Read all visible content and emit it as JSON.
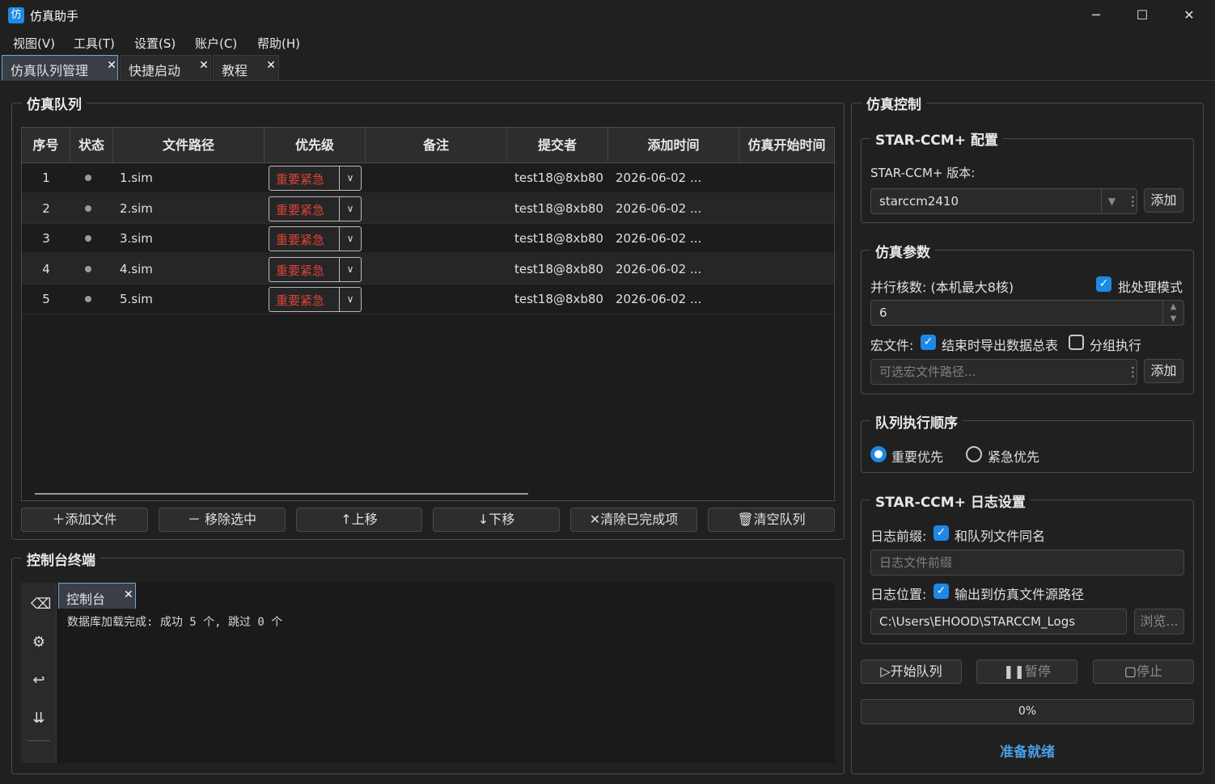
{
  "window": {
    "icon_char": "仿",
    "title": "仿真助手",
    "minimize": "─",
    "maximize": "☐",
    "close": "✕"
  },
  "menu": [
    "视图(V)",
    "工具(T)",
    "设置(S)",
    "账户(C)",
    "帮助(H)"
  ],
  "tabs": [
    {
      "label": "仿真队列管理",
      "active": true
    },
    {
      "label": "快捷启动",
      "active": false
    },
    {
      "label": "教程",
      "active": false
    }
  ],
  "queue": {
    "title": "仿真队列",
    "columns": [
      "序号",
      "状态",
      "文件路径",
      "优先级",
      "备注",
      "提交者",
      "添加时间",
      "仿真开始时间"
    ],
    "rows": [
      {
        "index": "1",
        "file": "1.sim",
        "priority": "重要紧急",
        "note": "",
        "submitter": "test18@8xb80",
        "added": "2026-06-02 ...",
        "start": ""
      },
      {
        "index": "2",
        "file": "2.sim",
        "priority": "重要紧急",
        "note": "",
        "submitter": "test18@8xb80",
        "added": "2026-06-02 ...",
        "start": ""
      },
      {
        "index": "3",
        "file": "3.sim",
        "priority": "重要紧急",
        "note": "",
        "submitter": "test18@8xb80",
        "added": "2026-06-02 ...",
        "start": ""
      },
      {
        "index": "4",
        "file": "4.sim",
        "priority": "重要紧急",
        "note": "",
        "submitter": "test18@8xb80",
        "added": "2026-06-02 ...",
        "start": ""
      },
      {
        "index": "5",
        "file": "5.sim",
        "priority": "重要紧急",
        "note": "",
        "submitter": "test18@8xb80",
        "added": "2026-06-02 ...",
        "start": ""
      }
    ],
    "buttons": {
      "add": "添加文件",
      "remove": "移除选中",
      "up": "上移",
      "down": "下移",
      "clear_done": "清除已完成项",
      "clear_all": "清空队列"
    }
  },
  "console": {
    "title": "控制台终端",
    "tab": "控制台",
    "text": "数据库加载完成: 成功 5 个, 跳过 0 个"
  },
  "control": {
    "title": "仿真控制",
    "star_config": {
      "title": "STAR-CCM+ 配置",
      "version_label": "STAR-CCM+ 版本:",
      "version": "starccm2410",
      "add": "添加"
    },
    "params": {
      "title": "仿真参数",
      "cores_label": "并行核数: (本机最大8核)",
      "batch_label": "批处理模式",
      "batch_checked": true,
      "cores": "6",
      "macro_label": "宏文件:",
      "export_label": "结束时导出数据总表",
      "export_checked": true,
      "group_label": "分组执行",
      "group_checked": false,
      "macro_placeholder": "可选宏文件路径...",
      "add": "添加"
    },
    "order": {
      "title": "队列执行顺序",
      "opt1": "重要优先",
      "opt2": "紧急优先",
      "selected": "重要优先"
    },
    "log": {
      "title": "STAR-CCM+ 日志设置",
      "prefix_label": "日志前缀:",
      "same_name": "和队列文件同名",
      "same_name_checked": true,
      "prefix_placeholder": "日志文件前缀",
      "location_label": "日志位置:",
      "to_source": "输出到仿真文件源路径",
      "to_source_checked": true,
      "path": "C:\\Users\\EHOOD\\STARCCM_Logs",
      "browse": "浏览..."
    },
    "actions": {
      "start": "开始队列",
      "pause": "暂停",
      "stop": "停止"
    },
    "progress": "0%",
    "progress_value": 0,
    "status": "准备就绪",
    "status_color": "#4a9fe8"
  }
}
